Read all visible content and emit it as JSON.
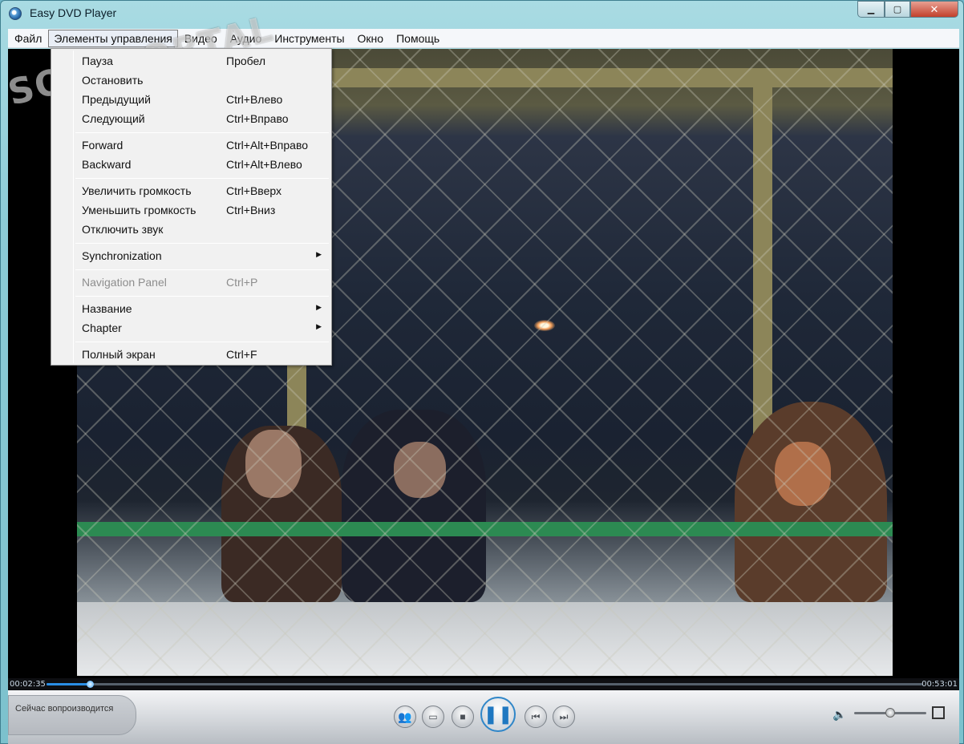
{
  "window": {
    "title": "Easy DVD Player"
  },
  "menubar": [
    {
      "label": "Файл"
    },
    {
      "label": "Элементы управления"
    },
    {
      "label": "Видео"
    },
    {
      "label": "Аудио"
    },
    {
      "label": "Инструменты"
    },
    {
      "label": "Окно"
    },
    {
      "label": "Помощь"
    }
  ],
  "dropdown": {
    "items": [
      {
        "label": "Пауза",
        "shortcut": "Пробел"
      },
      {
        "label": "Остановить",
        "shortcut": ""
      },
      {
        "label": "Предыдущий",
        "shortcut": "Ctrl+Влево"
      },
      {
        "label": "Следующий",
        "shortcut": "Ctrl+Вправо"
      },
      {
        "label": "Forward",
        "shortcut": "Ctrl+Alt+Вправо"
      },
      {
        "label": "Backward",
        "shortcut": "Ctrl+Alt+Влево"
      },
      {
        "label": "Увеличить громкость",
        "shortcut": "Ctrl+Вверх"
      },
      {
        "label": "Уменьшить громкость",
        "shortcut": "Ctrl+Вниз"
      },
      {
        "label": "Отключить звук",
        "shortcut": ""
      },
      {
        "label": "Synchronization",
        "shortcut": "",
        "submenu": true
      },
      {
        "label": "Navigation Panel",
        "shortcut": "Ctrl+P",
        "disabled": true
      },
      {
        "label": "Название",
        "shortcut": "",
        "submenu": true
      },
      {
        "label": "Chapter",
        "shortcut": "",
        "submenu": true
      },
      {
        "label": "Полный экран",
        "shortcut": "Ctrl+F"
      }
    ]
  },
  "watermark": {
    "text": "SOFTPORTAL",
    "url": "www.softportal.com"
  },
  "playback": {
    "elapsed": "00:02:35",
    "total": "00:53:01",
    "progress": 0.049,
    "volume": 0.5,
    "now_playing_label": "Сейчас вопроизводится"
  },
  "controls": {
    "icons": [
      "people-icon",
      "folder-icon",
      "stop-icon",
      "pause-icon",
      "previous-icon",
      "next-icon"
    ]
  },
  "colors": {
    "accent": "#2f86c8",
    "menu_bg": "#f1f1f1",
    "rail_green": "#2c8a52"
  }
}
